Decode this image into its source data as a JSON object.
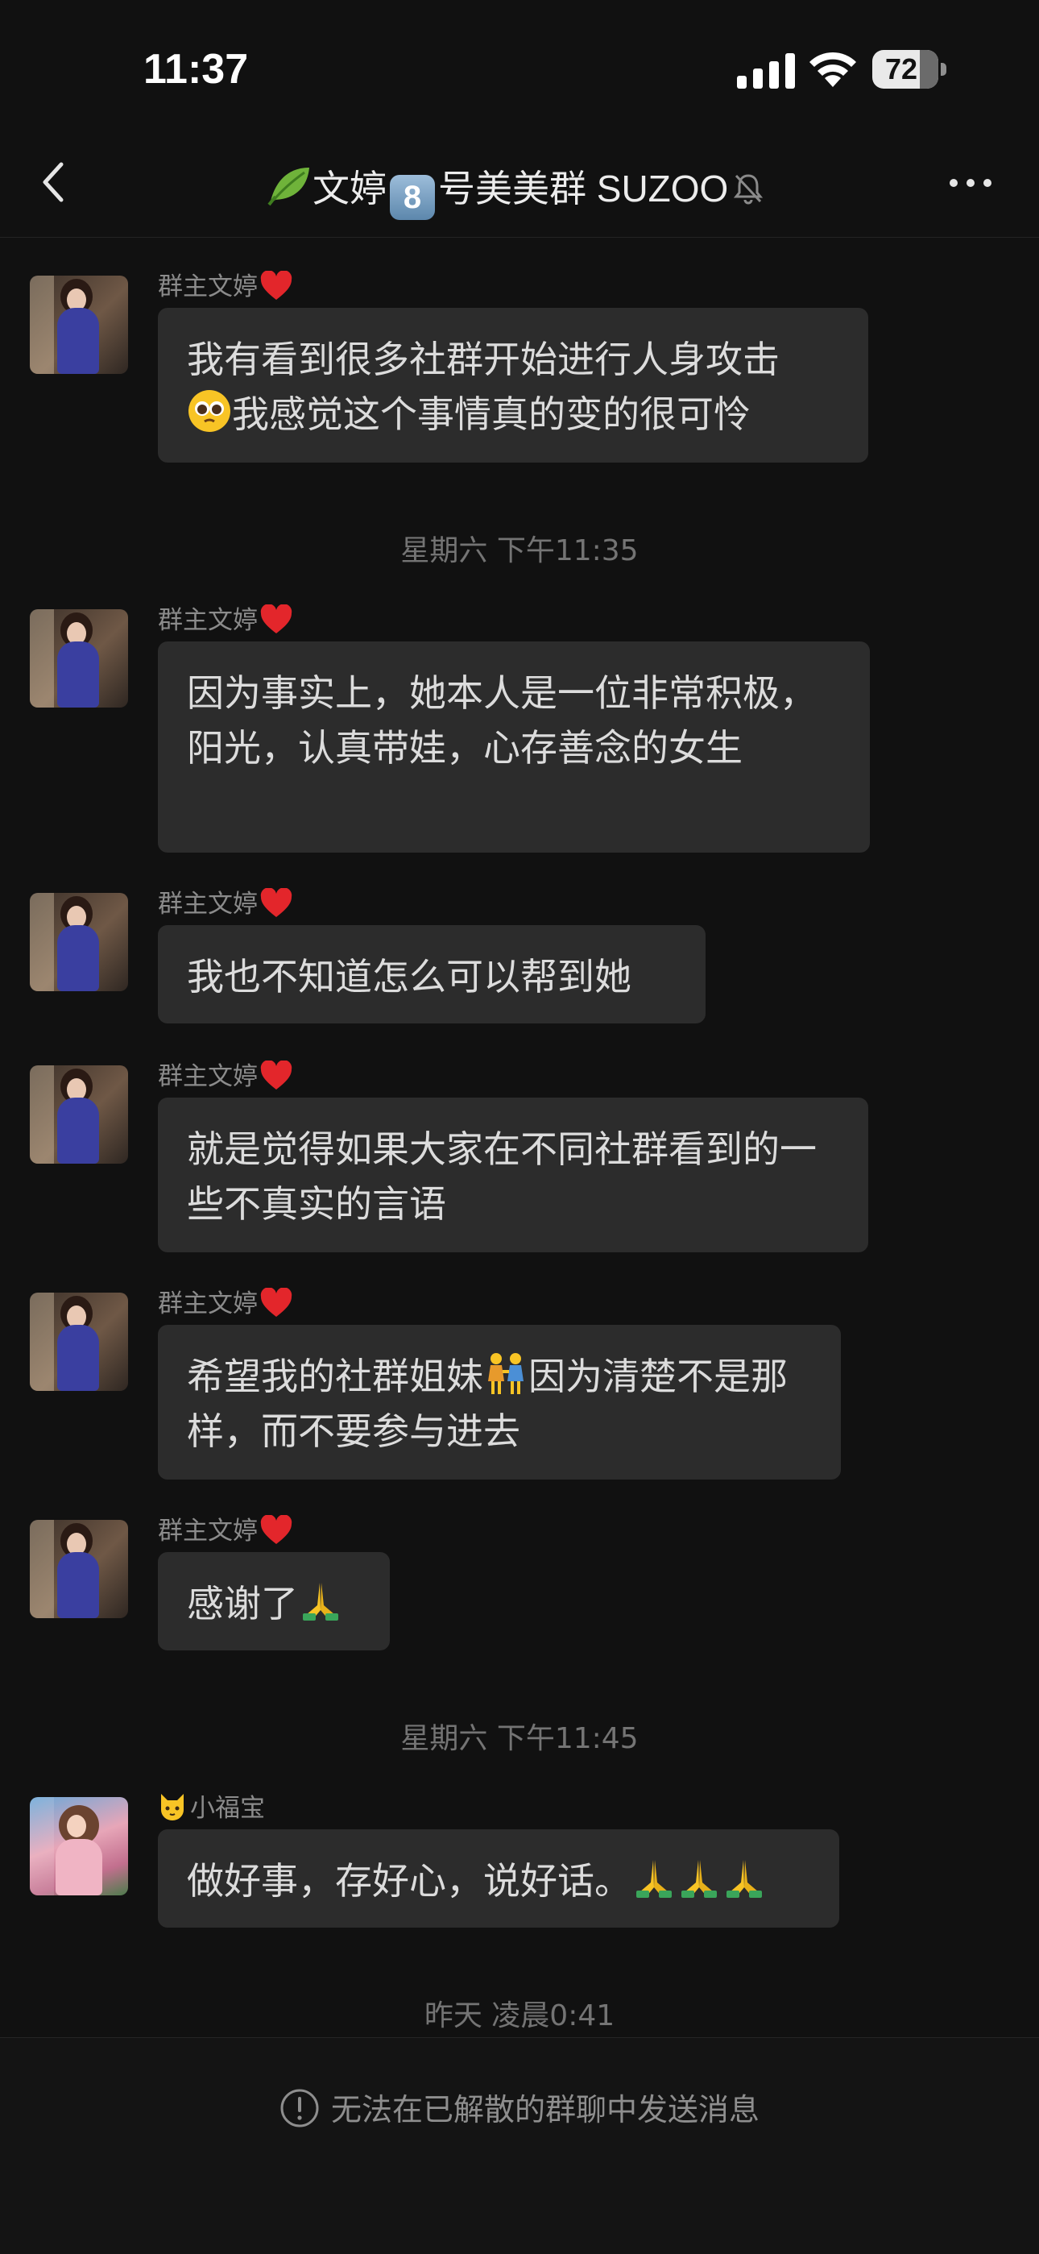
{
  "status_bar": {
    "time": "11:37",
    "battery_level": "72",
    "battery_fraction": 0.72
  },
  "header": {
    "title_part1": "文婷",
    "title_number": "8",
    "title_part2": "号美美群 SUZOO",
    "icons": [
      "back-icon",
      "leaf-icon",
      "keycap-8-icon",
      "bell-muted-icon",
      "more-icon"
    ]
  },
  "messages": [
    {
      "sender": "群主文婷",
      "line1": "我有看到很多社群开始进行人身攻击",
      "line2": "我感觉这个事情真的变的很可怜"
    },
    {
      "sender": "群主文婷",
      "text": "因为事实上，她本人是一位非常积极，阳光，认真带娃，心存善念的女生"
    },
    {
      "sender": "群主文婷",
      "text": "我也不知道怎么可以帮到她"
    },
    {
      "sender": "群主文婷",
      "text": "就是觉得如果大家在不同社群看到的一些不真实的言语"
    },
    {
      "sender": "群主文婷",
      "part1": "希望我的社群姐妹",
      "part2": "因为清楚不是那样，而不要参与进去"
    },
    {
      "sender": "群主文婷",
      "text": "感谢了"
    },
    {
      "sender": "小福宝",
      "text": "做好事，存好心，说好话。"
    }
  ],
  "timestamps": [
    "星期六 下午11:35",
    "星期六 下午11:45",
    "昨天 凌晨0:41"
  ],
  "footer": {
    "notice": "无法在已解散的群聊中发送消息"
  }
}
